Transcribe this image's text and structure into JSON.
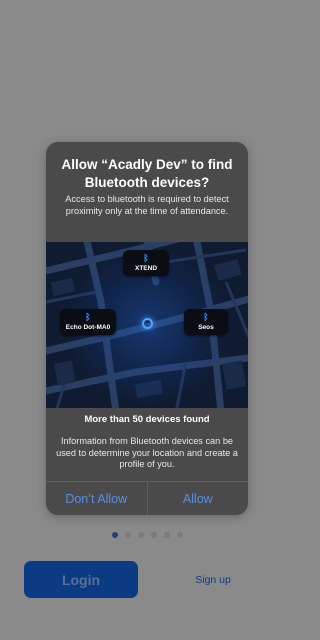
{
  "background": {
    "pager": {
      "count": 6,
      "active_index": 0
    },
    "login_label": "Login",
    "signup_label": "Sign up"
  },
  "dialog": {
    "title": "Allow “Acadly Dev” to find Bluetooth devices?",
    "message": "Access to bluetooth is required to detect proximity only at the time of attendance.",
    "map": {
      "devices": [
        {
          "name": "XTEND",
          "icon": "bluetooth-icon"
        },
        {
          "name": "Echo Dot-MA0",
          "icon": "bluetooth-icon"
        },
        {
          "name": "Seos",
          "icon": "bluetooth-icon"
        }
      ],
      "center_icon": "current-device-dot"
    },
    "found_text": "More than 50 devices found",
    "info_text": "Information from Bluetooth devices can be used to determine your location and create a profile of you.",
    "deny_label": "Don’t Allow",
    "allow_label": "Allow"
  },
  "colors": {
    "accent": "#5b8fe0",
    "login_button": "#0b3b82",
    "bluetooth": "#3d8bff"
  }
}
